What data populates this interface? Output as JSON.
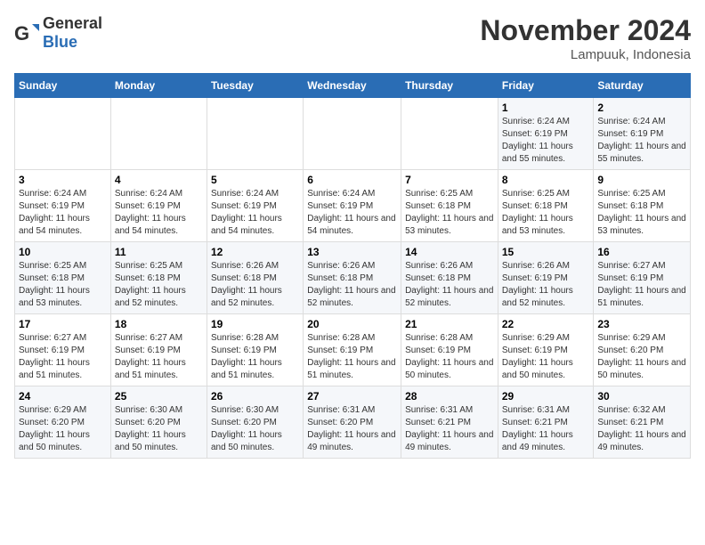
{
  "logo": {
    "text_general": "General",
    "text_blue": "Blue"
  },
  "title": "November 2024",
  "location": "Lampuuk, Indonesia",
  "weekdays": [
    "Sunday",
    "Monday",
    "Tuesday",
    "Wednesday",
    "Thursday",
    "Friday",
    "Saturday"
  ],
  "weeks": [
    [
      {
        "day": "",
        "info": ""
      },
      {
        "day": "",
        "info": ""
      },
      {
        "day": "",
        "info": ""
      },
      {
        "day": "",
        "info": ""
      },
      {
        "day": "",
        "info": ""
      },
      {
        "day": "1",
        "info": "Sunrise: 6:24 AM\nSunset: 6:19 PM\nDaylight: 11 hours and 55 minutes."
      },
      {
        "day": "2",
        "info": "Sunrise: 6:24 AM\nSunset: 6:19 PM\nDaylight: 11 hours and 55 minutes."
      }
    ],
    [
      {
        "day": "3",
        "info": "Sunrise: 6:24 AM\nSunset: 6:19 PM\nDaylight: 11 hours and 54 minutes."
      },
      {
        "day": "4",
        "info": "Sunrise: 6:24 AM\nSunset: 6:19 PM\nDaylight: 11 hours and 54 minutes."
      },
      {
        "day": "5",
        "info": "Sunrise: 6:24 AM\nSunset: 6:19 PM\nDaylight: 11 hours and 54 minutes."
      },
      {
        "day": "6",
        "info": "Sunrise: 6:24 AM\nSunset: 6:19 PM\nDaylight: 11 hours and 54 minutes."
      },
      {
        "day": "7",
        "info": "Sunrise: 6:25 AM\nSunset: 6:18 PM\nDaylight: 11 hours and 53 minutes."
      },
      {
        "day": "8",
        "info": "Sunrise: 6:25 AM\nSunset: 6:18 PM\nDaylight: 11 hours and 53 minutes."
      },
      {
        "day": "9",
        "info": "Sunrise: 6:25 AM\nSunset: 6:18 PM\nDaylight: 11 hours and 53 minutes."
      }
    ],
    [
      {
        "day": "10",
        "info": "Sunrise: 6:25 AM\nSunset: 6:18 PM\nDaylight: 11 hours and 53 minutes."
      },
      {
        "day": "11",
        "info": "Sunrise: 6:25 AM\nSunset: 6:18 PM\nDaylight: 11 hours and 52 minutes."
      },
      {
        "day": "12",
        "info": "Sunrise: 6:26 AM\nSunset: 6:18 PM\nDaylight: 11 hours and 52 minutes."
      },
      {
        "day": "13",
        "info": "Sunrise: 6:26 AM\nSunset: 6:18 PM\nDaylight: 11 hours and 52 minutes."
      },
      {
        "day": "14",
        "info": "Sunrise: 6:26 AM\nSunset: 6:18 PM\nDaylight: 11 hours and 52 minutes."
      },
      {
        "day": "15",
        "info": "Sunrise: 6:26 AM\nSunset: 6:19 PM\nDaylight: 11 hours and 52 minutes."
      },
      {
        "day": "16",
        "info": "Sunrise: 6:27 AM\nSunset: 6:19 PM\nDaylight: 11 hours and 51 minutes."
      }
    ],
    [
      {
        "day": "17",
        "info": "Sunrise: 6:27 AM\nSunset: 6:19 PM\nDaylight: 11 hours and 51 minutes."
      },
      {
        "day": "18",
        "info": "Sunrise: 6:27 AM\nSunset: 6:19 PM\nDaylight: 11 hours and 51 minutes."
      },
      {
        "day": "19",
        "info": "Sunrise: 6:28 AM\nSunset: 6:19 PM\nDaylight: 11 hours and 51 minutes."
      },
      {
        "day": "20",
        "info": "Sunrise: 6:28 AM\nSunset: 6:19 PM\nDaylight: 11 hours and 51 minutes."
      },
      {
        "day": "21",
        "info": "Sunrise: 6:28 AM\nSunset: 6:19 PM\nDaylight: 11 hours and 50 minutes."
      },
      {
        "day": "22",
        "info": "Sunrise: 6:29 AM\nSunset: 6:19 PM\nDaylight: 11 hours and 50 minutes."
      },
      {
        "day": "23",
        "info": "Sunrise: 6:29 AM\nSunset: 6:20 PM\nDaylight: 11 hours and 50 minutes."
      }
    ],
    [
      {
        "day": "24",
        "info": "Sunrise: 6:29 AM\nSunset: 6:20 PM\nDaylight: 11 hours and 50 minutes."
      },
      {
        "day": "25",
        "info": "Sunrise: 6:30 AM\nSunset: 6:20 PM\nDaylight: 11 hours and 50 minutes."
      },
      {
        "day": "26",
        "info": "Sunrise: 6:30 AM\nSunset: 6:20 PM\nDaylight: 11 hours and 50 minutes."
      },
      {
        "day": "27",
        "info": "Sunrise: 6:31 AM\nSunset: 6:20 PM\nDaylight: 11 hours and 49 minutes."
      },
      {
        "day": "28",
        "info": "Sunrise: 6:31 AM\nSunset: 6:21 PM\nDaylight: 11 hours and 49 minutes."
      },
      {
        "day": "29",
        "info": "Sunrise: 6:31 AM\nSunset: 6:21 PM\nDaylight: 11 hours and 49 minutes."
      },
      {
        "day": "30",
        "info": "Sunrise: 6:32 AM\nSunset: 6:21 PM\nDaylight: 11 hours and 49 minutes."
      }
    ]
  ]
}
